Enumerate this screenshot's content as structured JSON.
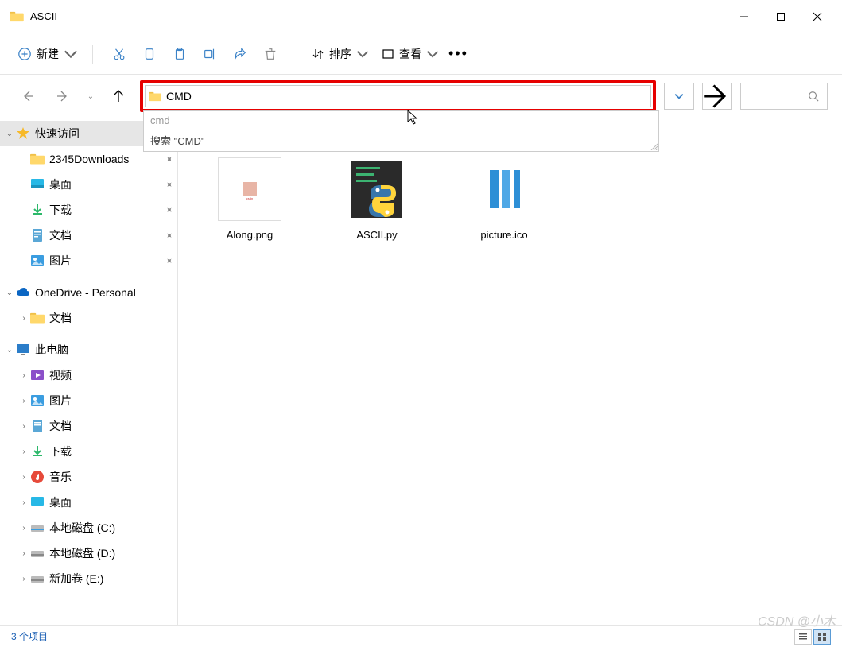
{
  "titlebar": {
    "title": "ASCII"
  },
  "toolbar": {
    "new_label": "新建",
    "sort_label": "排序",
    "view_label": "查看"
  },
  "address": {
    "value": "CMD",
    "dropdown": {
      "item1": "cmd",
      "item2": "搜索 \"CMD\""
    }
  },
  "sidebar": {
    "quick_access": "快速访问",
    "downloads_2345": "2345Downloads",
    "desktop": "桌面",
    "downloads": "下载",
    "documents": "文档",
    "pictures": "图片",
    "onedrive": "OneDrive - Personal",
    "od_documents": "文档",
    "this_pc": "此电脑",
    "videos": "视频",
    "pc_pictures": "图片",
    "pc_documents": "文档",
    "pc_downloads": "下载",
    "music": "音乐",
    "pc_desktop": "桌面",
    "drive_c": "本地磁盘 (C:)",
    "drive_d": "本地磁盘 (D:)",
    "drive_e": "新加卷 (E:)"
  },
  "files": {
    "f1": "Along.png",
    "f2": "ASCII.py",
    "f3": "picture.ico"
  },
  "statusbar": {
    "count": "3 个项目"
  },
  "watermark": "CSDN @小木"
}
